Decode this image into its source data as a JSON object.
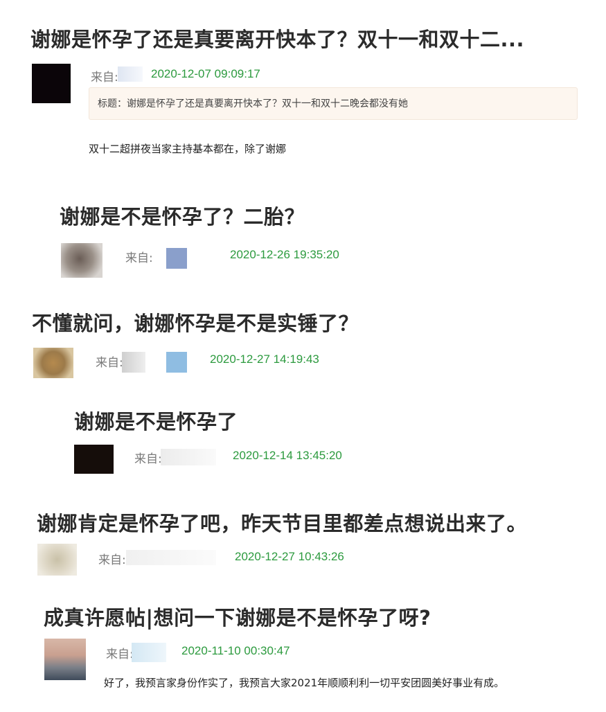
{
  "posts": [
    {
      "title": "谢娜是怀孕了还是真要离开快本了？双十一和双十二...",
      "from_label": "来自:",
      "timestamp": "2020-12-07 09:09:17",
      "quote": "标题：谢娜是怀孕了还是真要离开快本了？双十一和双十二晚会都没有她",
      "body": "双十二超拼夜当家主持基本都在，除了谢娜"
    },
    {
      "title": "谢娜是不是怀孕了？二胎？",
      "from_label": "来自:",
      "timestamp": "2020-12-26 19:35:20"
    },
    {
      "title": "不懂就问，谢娜怀孕是不是实锤了？",
      "from_label": "来自:",
      "timestamp": "2020-12-27 14:19:43"
    },
    {
      "title": "谢娜是不是怀孕了",
      "from_label": "来自:",
      "timestamp": "2020-12-14 13:45:20"
    },
    {
      "title": "谢娜肯定是怀孕了吧，昨天节目里都差点想说出来了。",
      "from_label": "来自:",
      "timestamp": "2020-12-27 10:43:26"
    },
    {
      "title": "成真许愿帖|想问一下谢娜是不是怀孕了呀?",
      "from_label": "来自:",
      "timestamp": "2020-11-10 00:30:47",
      "body": "好了，我预言家身份作实了，我预言大家2021年顺顺利利一切平安团圆美好事业有成。"
    }
  ],
  "colors": {
    "timestamp": "#2c9a3e",
    "quote_bg": "#fdf6ef"
  }
}
